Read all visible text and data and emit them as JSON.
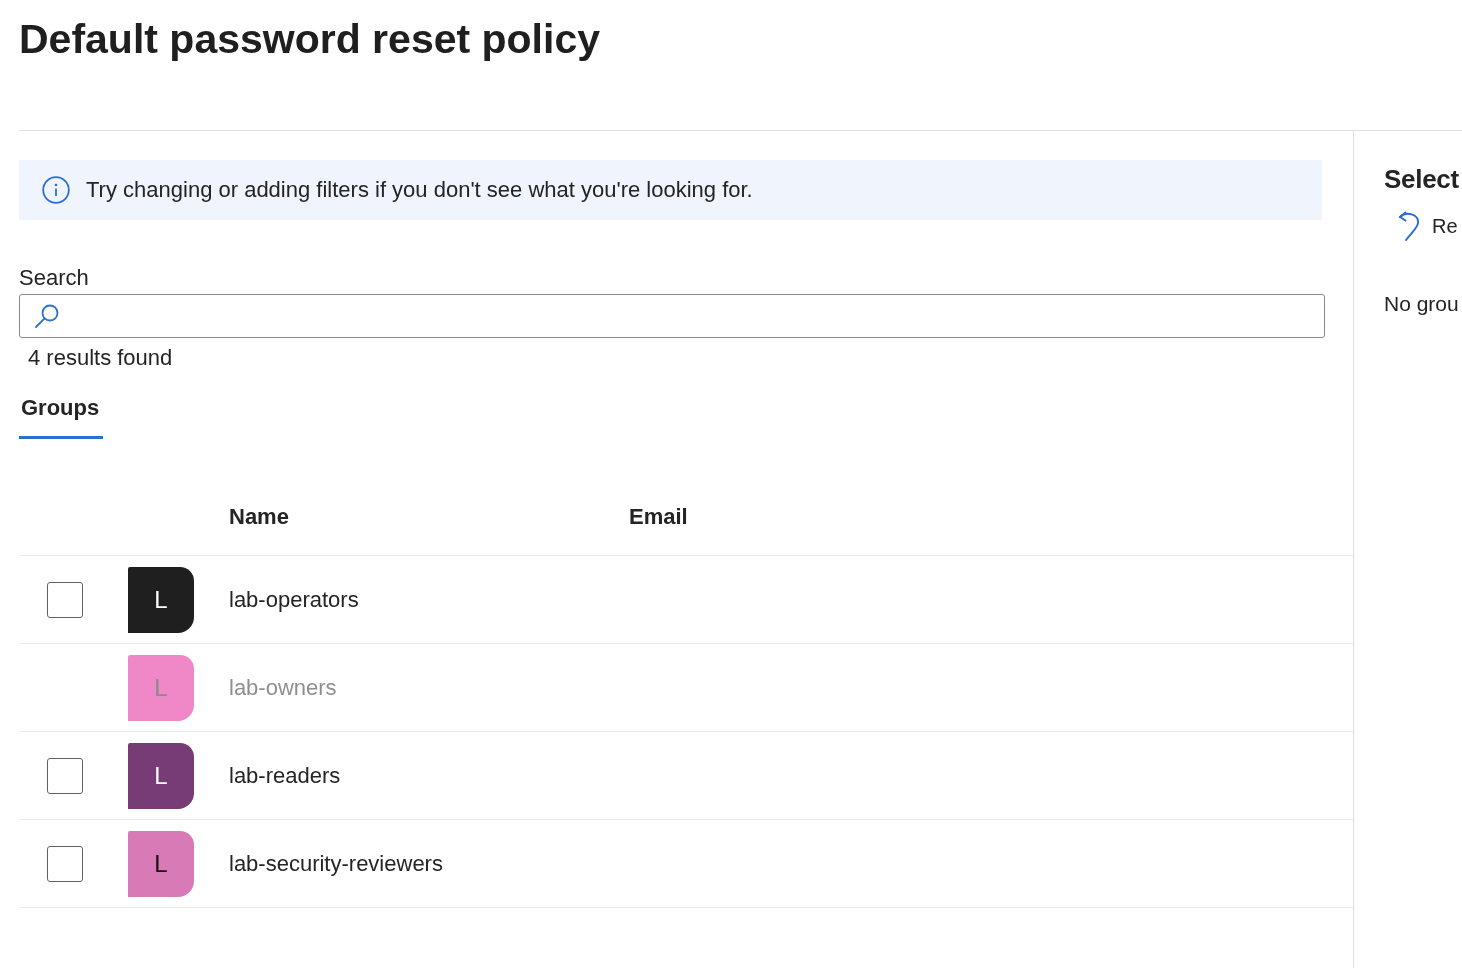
{
  "page": {
    "title": "Default password reset policy"
  },
  "info_bar": {
    "message": "Try changing or adding filters if you don't see what you're looking for."
  },
  "search": {
    "label": "Search"
  },
  "results_count": "4 results found",
  "tabs": [
    {
      "label": "Groups",
      "selected": true
    }
  ],
  "table": {
    "columns": [
      "Name",
      "Email"
    ],
    "rows": [
      {
        "initial": "L",
        "name": "lab-operators",
        "color": "#1f1f1f",
        "checked": false,
        "disabled": false
      },
      {
        "initial": "L",
        "name": "lab-owners",
        "color": "#f088c8",
        "checked": false,
        "disabled": true
      },
      {
        "initial": "L",
        "name": "lab-readers",
        "color": "#773b75",
        "checked": false,
        "disabled": false
      },
      {
        "initial": "L",
        "name": "lab-security-reviewers",
        "color": "#d87ab6",
        "checked": false,
        "disabled": false
      }
    ]
  },
  "selected_panel": {
    "title": "Select",
    "action": "Re",
    "empty_message": "No grou"
  }
}
